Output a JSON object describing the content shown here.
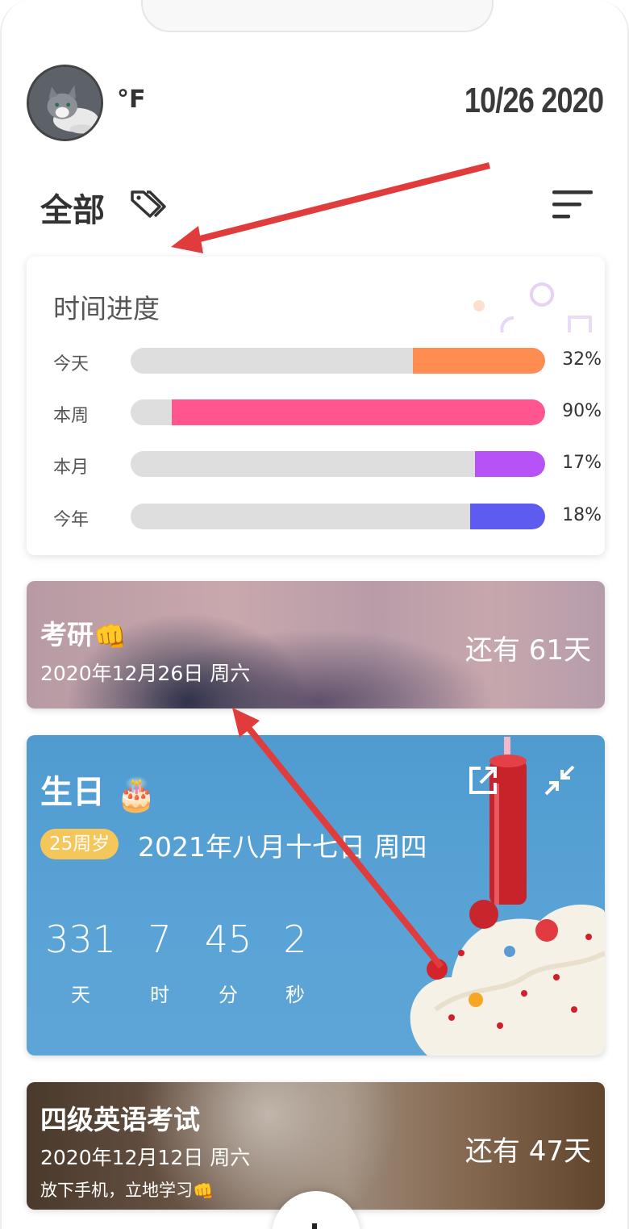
{
  "header": {
    "temperature": "°F",
    "date": "10/26 2020"
  },
  "filter": {
    "title": "全部",
    "tag_icon": "tag-icon",
    "sort_icon": "sort-icon"
  },
  "progress": {
    "title": "时间进度",
    "rows": [
      {
        "label": "今天",
        "percent_text": "32%",
        "value": 0.32,
        "color": "#ff8c50"
      },
      {
        "label": "本周",
        "percent_text": "90%",
        "value": 0.9,
        "color": "#ff5690"
      },
      {
        "label": "本月",
        "percent_text": "17%",
        "value": 0.17,
        "color": "#b753f6"
      },
      {
        "label": "今年",
        "percent_text": "18%",
        "value": 0.18,
        "color": "#5e5cf0"
      }
    ]
  },
  "events": {
    "kaoyan": {
      "name": "考研",
      "emoji": "👊",
      "date": "2020年12月26日 周六",
      "remaining": "还有 61天"
    },
    "birthday": {
      "name": "生日",
      "emoji": "🎂",
      "age_badge": "25周岁",
      "date": "2021年八月十七日 周四",
      "countdown": [
        {
          "value": "331",
          "unit": "天"
        },
        {
          "value": "7",
          "unit": "时"
        },
        {
          "value": "45",
          "unit": "分"
        },
        {
          "value": "2",
          "unit": "秒"
        }
      ]
    },
    "cet4": {
      "name": "四级英语考试",
      "date": "2020年12月12日 周六",
      "note": "放下手机，立地学习",
      "note_emoji": "👊",
      "remaining": "还有 47天"
    }
  },
  "colors": {
    "annotation_arrow": "#e03c3c",
    "badge": "#f5c75b"
  }
}
